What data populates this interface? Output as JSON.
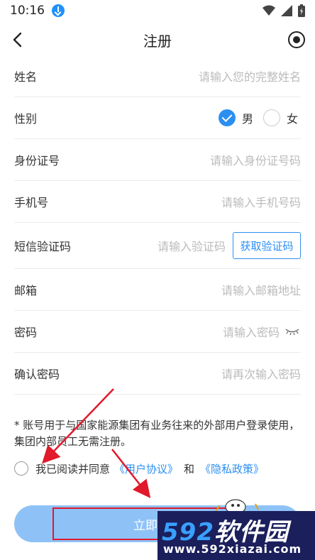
{
  "status_bar": {
    "time": "10:16"
  },
  "header": {
    "title": "注册"
  },
  "form": {
    "name": {
      "label": "姓名",
      "placeholder": "请输入您的完整姓名"
    },
    "gender": {
      "label": "性别",
      "options": [
        "男",
        "女"
      ],
      "selected": "男"
    },
    "id_card": {
      "label": "身份证号",
      "placeholder": "请输入身份证号码"
    },
    "phone": {
      "label": "手机号",
      "placeholder": "请输入手机号码"
    },
    "sms": {
      "label": "短信验证码",
      "placeholder": "请输入验证码",
      "button": "获取验证码"
    },
    "email": {
      "label": "邮箱",
      "placeholder": "请输入邮箱地址"
    },
    "password": {
      "label": "密码",
      "placeholder": "请输入密码"
    },
    "confirm_password": {
      "label": "确认密码",
      "placeholder": "请再次输入密码"
    }
  },
  "notice": "* 账号用于与国家能源集团有业务往来的外部用户登录使用，集团内部员工无需注册。",
  "agreement": {
    "prefix": "我已阅读并同意",
    "user_agreement": "《用户协议》",
    "and": "和",
    "privacy_policy": "《隐私政策》"
  },
  "register_button": "立即注册",
  "watermark": {
    "brand_num": "592",
    "brand_text": "软件园",
    "url": "www.592xiazai.com"
  },
  "colors": {
    "accent": "#2b8ff2",
    "button": "#8ec2f7",
    "annotation": "#e0192b"
  }
}
